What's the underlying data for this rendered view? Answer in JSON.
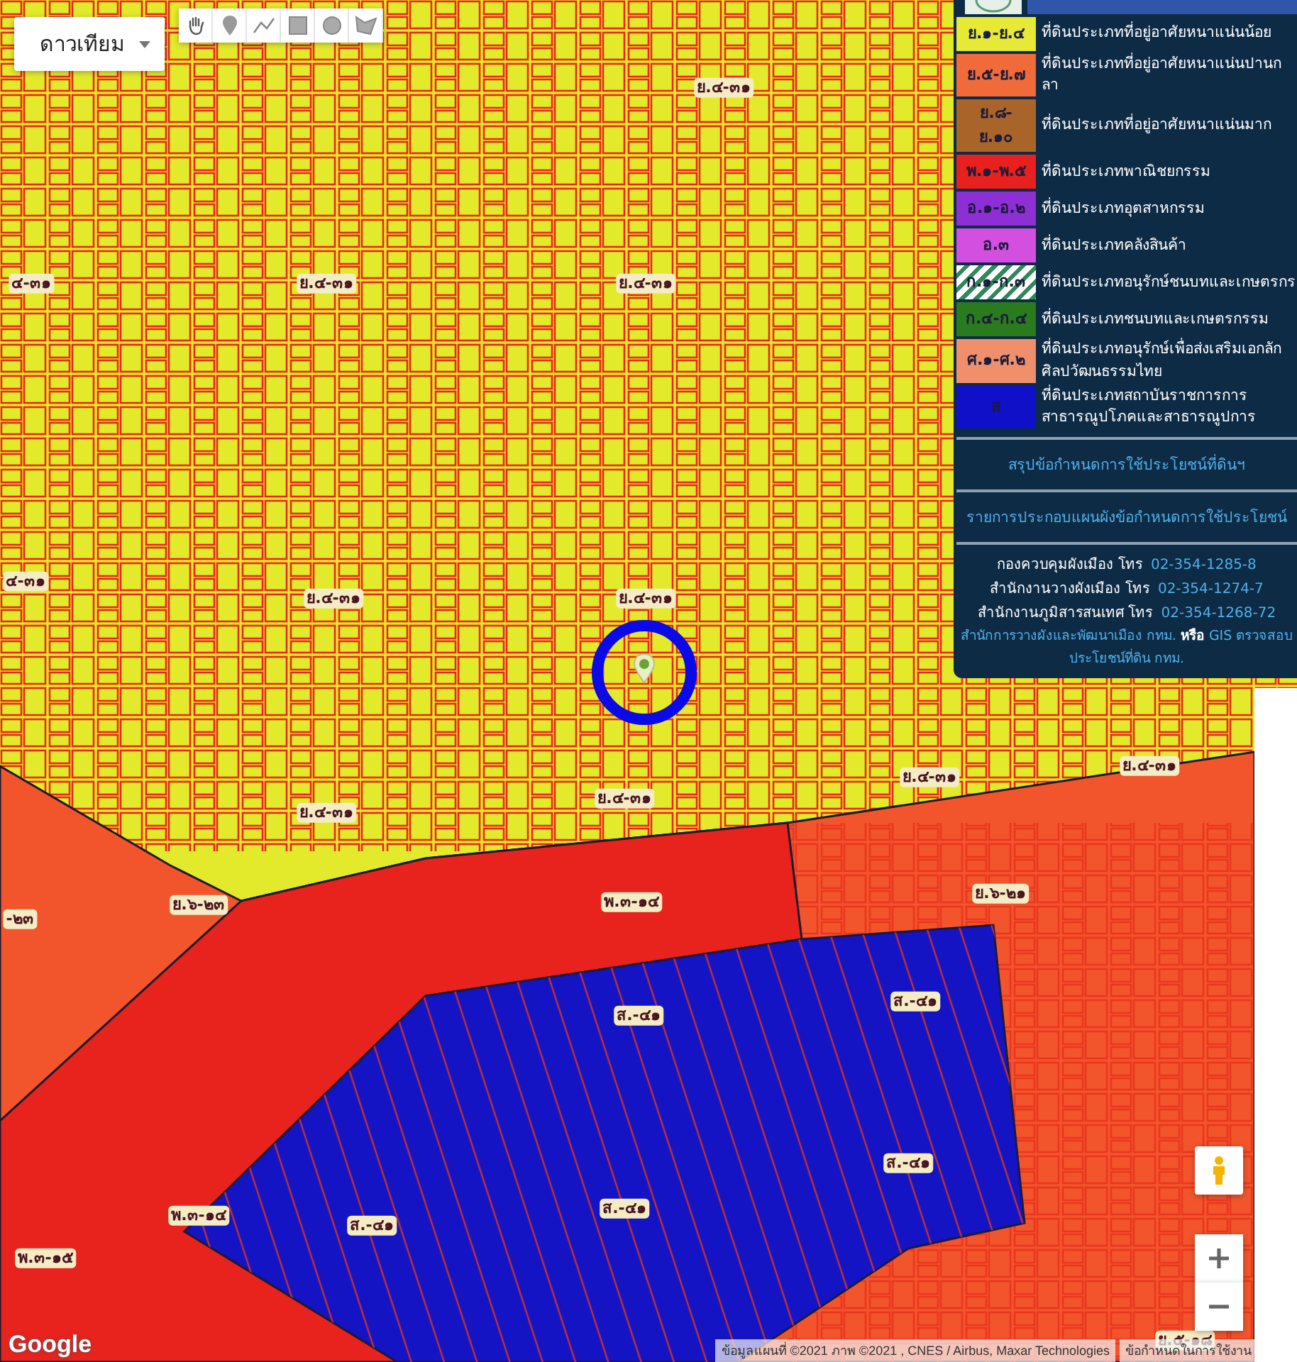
{
  "map_type": {
    "label": "ดาวเทียม"
  },
  "zone_labels": [
    "ย.๔-๓๑",
    "๔-๓๑",
    "ย.๔-๓๑",
    "ย.๔-๓๑",
    "๔-๓๑",
    "ย.๔-๓๑",
    "ย.๔-๓๑",
    "ย.๔-๓๑",
    "ย.๔-๓๑",
    "ย.๔-๓๑",
    "ย.๔-๓๑",
    "ย.๖-๒๓",
    "-๒๓",
    "พ.๓-๑๔",
    "ย.๖-๒๑",
    "ส.-๔๑",
    "ส.-๔๑",
    "ส.-๔๑",
    "ส.-๔๑",
    "ส.-๔๑",
    "พ.๓-๑๔",
    "พ.๓-๑๕",
    "ย.๕-๑๘"
  ],
  "legend": {
    "items": [
      {
        "code": "ย.๑-ย.๔",
        "color": "#e6ea36",
        "kind": "solid",
        "description": "ที่ดินประเภทที่อยู่อาศัยหนาแน่นน้อย"
      },
      {
        "code": "ย.๕-ย.๗",
        "color": "#f06a3a",
        "kind": "solid",
        "description": "ที่ดินประเภทที่อยู่อาศัยหนาแน่นปานกลา"
      },
      {
        "code": "ย.๘-ย.๑๐",
        "color": "#a9642a",
        "kind": "solid",
        "description": "ที่ดินประเภทที่อยู่อาศัยหนาแน่นมาก"
      },
      {
        "code": "พ.๑-พ.๕",
        "color": "#e8201e",
        "kind": "solid",
        "description": "ที่ดินประเภทพาณิชยกรรม"
      },
      {
        "code": "อ.๑-อ.๒",
        "color": "#8e2fd6",
        "kind": "solid",
        "description": "ที่ดินประเภทอุตสาหกรรม"
      },
      {
        "code": "อ.๓",
        "color": "#d24fe0",
        "kind": "solid",
        "description": "ที่ดินประเภทคลังสินค้า"
      },
      {
        "code": "ก.๑-ก.๓",
        "color": "#2f8a5a",
        "kind": "hatched",
        "description": "ที่ดินประเภทอนุรักษ์ชนบทและเกษตรกร"
      },
      {
        "code": "ก.๔-ก.๔",
        "color": "#2a7a1e",
        "kind": "solid",
        "description": "ที่ดินประเภทชนบทและเกษตรกรรม"
      },
      {
        "code": "ศ.๑-ศ.๒",
        "color": "#ef8f6c",
        "kind": "solid",
        "description": "ที่ดินประเภทอนุรักษ์เพื่อส่งเสริมเอกลัก ศิลปวัฒนธรรมไทย"
      },
      {
        "code": "ส",
        "color": "#1010c8",
        "kind": "solid",
        "description": "ที่ดินประเภทสถาบันราชการการ สาธารณูปโภคและสาธารณูปการ"
      }
    ],
    "links": [
      "สรุปข้อกำหนดการใช้ประโยชน์ที่ดินฯ",
      "รายการประกอบแผนผังข้อกำหนดการใช้ประโยชน์"
    ],
    "contacts": [
      {
        "office": "กองควบคุมผังเมือง โทร",
        "phone": "02-354-1285-8"
      },
      {
        "office": "สำนักงานวางผังเมือง โทร",
        "phone": "02-354-1274-7"
      },
      {
        "office": "สำนักงานภูมิสารสนเทศ โทร",
        "phone": "02-354-1268-72"
      }
    ],
    "note": [
      {
        "kind": "link",
        "text": "สำนักการวางผังและพัฒนาเมือง กทม."
      },
      {
        "kind": "plain",
        "text": "หรือ"
      },
      {
        "kind": "link",
        "text": "GIS ตรวจสอบ"
      },
      {
        "kind": "link",
        "text": "ประโยชน์ที่ดิน กทม."
      }
    ]
  },
  "map_footer": {
    "logo": "Google",
    "attribution": "ข้อมูลแผนที่ ©2021 ภาพ ©2021 , CNES / Airbus, Maxar Technologies",
    "terms": "ข้อกำหนดในการใช้งาน"
  }
}
